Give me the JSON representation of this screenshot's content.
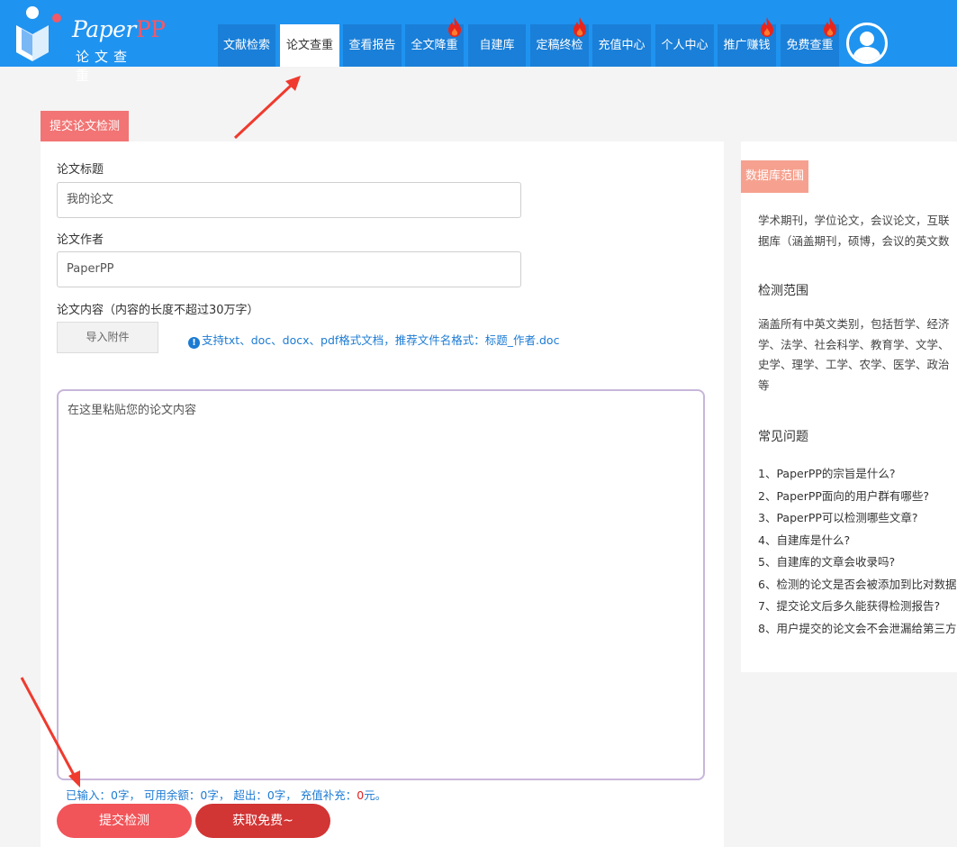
{
  "brand": {
    "name_main": "aper",
    "name_initial": "P",
    "name_pp": "PP",
    "subtitle": "论文查重"
  },
  "nav": [
    {
      "label": "文献检索",
      "active": false,
      "hot": false
    },
    {
      "label": "论文查重",
      "active": true,
      "hot": false
    },
    {
      "label": "查看报告",
      "active": false,
      "hot": false
    },
    {
      "label": "全文降重",
      "active": false,
      "hot": true
    },
    {
      "label": "自建库",
      "active": false,
      "hot": false
    },
    {
      "label": "定稿终检",
      "active": false,
      "hot": true
    },
    {
      "label": "充值中心",
      "active": false,
      "hot": false
    },
    {
      "label": "个人中心",
      "active": false,
      "hot": false
    },
    {
      "label": "推广赚钱",
      "active": false,
      "hot": true
    },
    {
      "label": "免费查重",
      "active": false,
      "hot": true
    }
  ],
  "section_tab": "提交论文检测",
  "form": {
    "title_label": "论文标题",
    "title_value": "我的论文",
    "author_label": "论文作者",
    "author_value": "PaperPP",
    "content_label": "论文内容（内容的长度不超过30万字）",
    "upload_label": "导入附件",
    "hint_icon": "!",
    "hint_text": "支持txt、doc、docx、pdf格式文档，推荐文件名格式：标题_作者.doc",
    "content_placeholder": "在这里粘贴您的论文内容"
  },
  "stats": {
    "prefix": "已输入：0字， 可用余额：0字， 超出：0字， 充值补充：",
    "amount": "0",
    "suffix": "元。"
  },
  "buttons": {
    "submit": "提交检测",
    "free": "获取免费~"
  },
  "right": {
    "db_tab": "数据库范围",
    "db_text_line1": "学术期刊，学位论文，会议论文，互联",
    "db_text_line2": "据库（涵盖期刊，硕博，会议的英文数",
    "scope_heading": "检测范围",
    "scope_line1": "涵盖所有中英文类别，包括哲学、经济",
    "scope_line2": "学、法学、社会科学、教育学、文学、",
    "scope_line3": "史学、理学、工学、农学、医学、政治",
    "scope_line4": "等",
    "faq_heading": "常见问题",
    "faq": [
      "1、PaperPP的宗旨是什么?",
      "2、PaperPP面向的用户群有哪些?",
      "3、PaperPP可以检测哪些文章?",
      "4、自建库是什么?",
      "5、自建库的文章会收录吗?",
      "6、检测的论文是否会被添加到比对数据",
      "7、提交论文后多久能获得检测报告?",
      "8、用户提交的论文会不会泄漏给第三方"
    ]
  },
  "colors": {
    "header": "#1f93f0",
    "nav_item": "#1a7fd8",
    "section_tab": "#f27474",
    "db_tab": "#f6a18f",
    "link": "#1c7bd3",
    "submit_button": "#f15459",
    "free_button": "#d13534",
    "annotation_arrow": "#f03a2e"
  }
}
